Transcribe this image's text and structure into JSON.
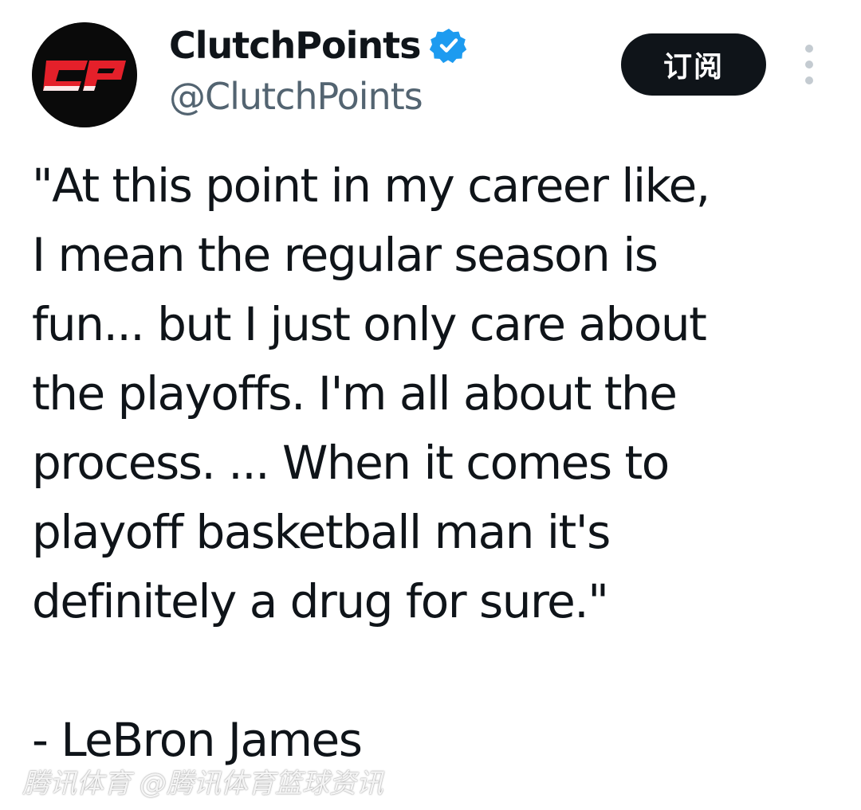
{
  "author": {
    "display_name": "ClutchPoints",
    "handle": "@ClutchPoints",
    "avatar_icon": "clutchpoints-cp-logo",
    "avatar_text": "CP",
    "verified_icon": "verified-badge-icon",
    "verified_color": "#1d9bf0"
  },
  "actions": {
    "subscribe_label": "订阅",
    "more_icon": "vertical-ellipsis-icon"
  },
  "tweet": {
    "lines": [
      "\"At this point in my career like,",
      "I mean the regular season is",
      "fun... but I just only care about",
      "the playoffs. I'm all about the",
      "process. ... When it comes to",
      "playoff basketball man it's",
      "definitely a drug for sure.\"",
      "",
      "- LeBron James"
    ]
  },
  "watermark": "腾讯体育 @腾讯体育篮球资讯",
  "colors": {
    "text": "#0f1419",
    "secondary_text": "#536471",
    "button_bg": "#0f1419",
    "logo_red": "#e4202a"
  }
}
